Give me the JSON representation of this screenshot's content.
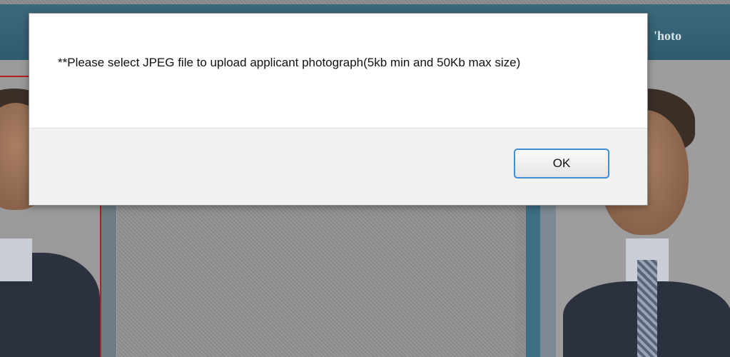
{
  "header": {
    "title_fragment": "'hoto"
  },
  "dialog": {
    "message": "**Please select JPEG file to upload applicant photograph(5kb min and 50Kb max size)",
    "ok_label": "OK"
  },
  "colors": {
    "header_bar": "#2f5b6e",
    "ok_button_border": "#3d8ed8",
    "red_frame": "#b02020"
  }
}
